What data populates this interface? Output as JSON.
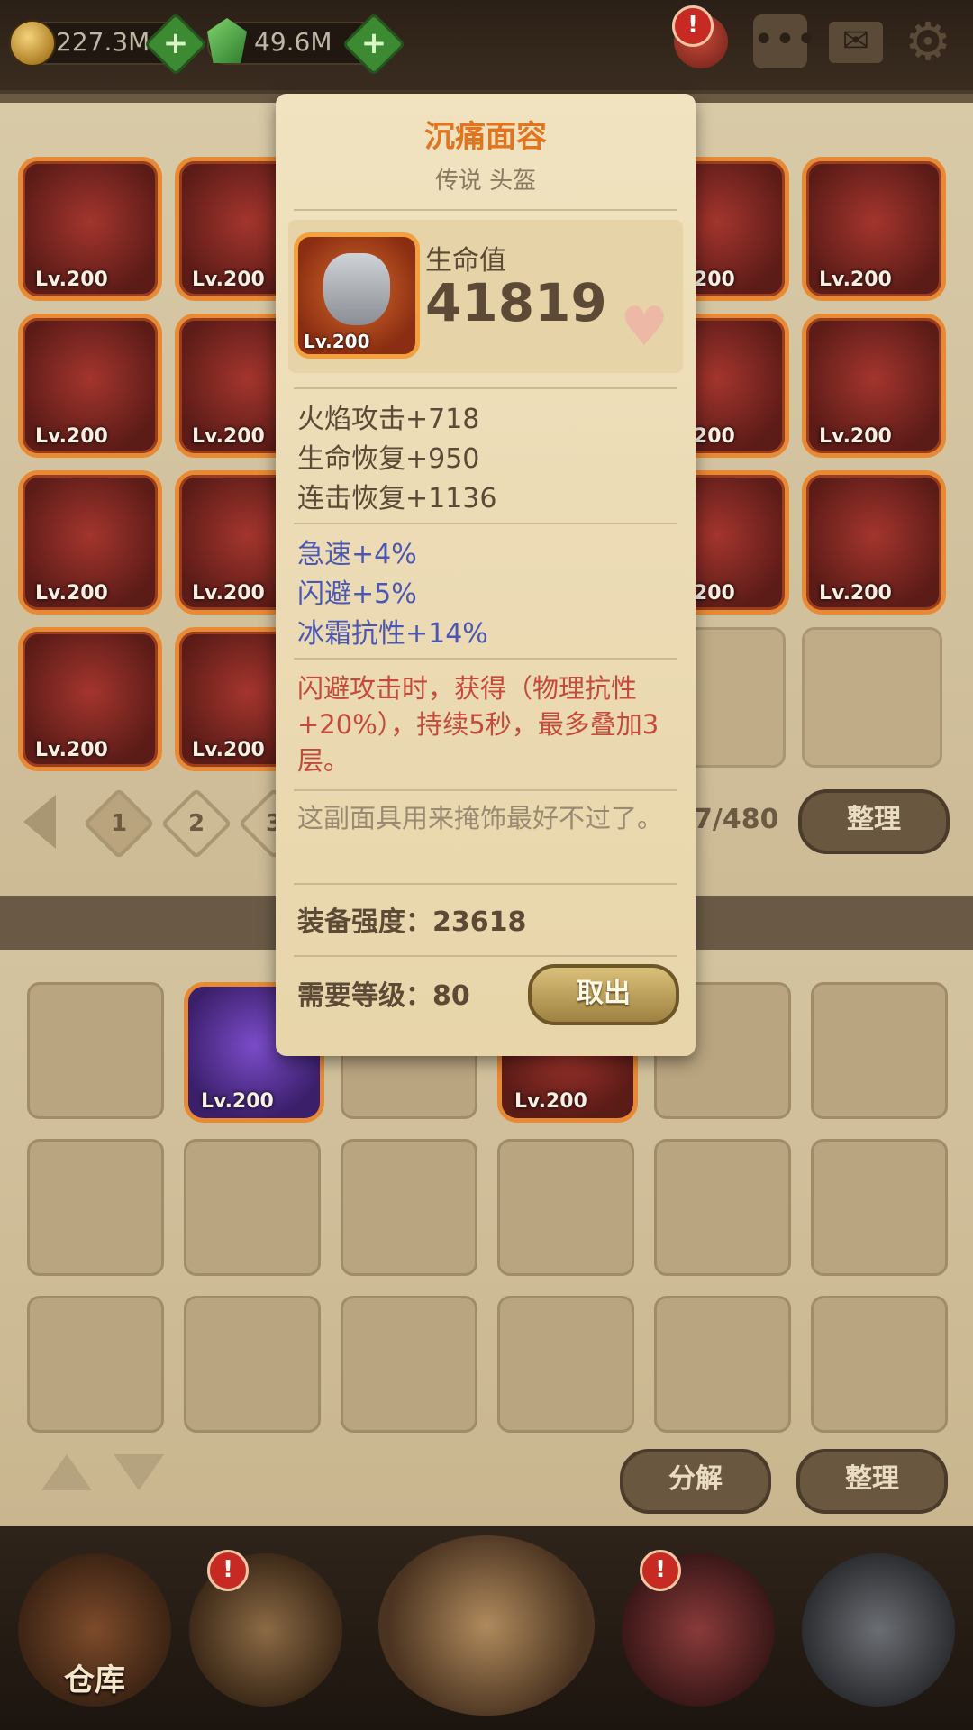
{
  "topbar": {
    "gold": "227.3M",
    "gems": "49.6M",
    "alert_glyph": "!"
  },
  "storage": {
    "level_label": "Lv.200",
    "pages": [
      "1",
      "2",
      "3"
    ],
    "count": "7/480",
    "sort_label": "整理"
  },
  "bag": {
    "level_label": "Lv.200",
    "decompose_label": "分解",
    "sort_label": "整理"
  },
  "nav": {
    "warehouse_label": "仓库",
    "alert_glyph": "!"
  },
  "item": {
    "name": "沉痛面容",
    "subtitle": "传说 头盔",
    "level": "Lv.200",
    "main_stat_label": "生命值",
    "main_stat_value": "41819",
    "stats": [
      "火焰攻击+718",
      "生命恢复+950",
      "连击恢复+1136"
    ],
    "bonus_stats": [
      "急速+4%",
      "闪避+5%",
      "冰霜抗性+14%"
    ],
    "effect": "闪避攻击时，获得（物理抗性+20%），持续5秒，最多叠加3层。",
    "flavor": "这副面具用来掩饰最好不过了。",
    "power_label": "装备强度：23618",
    "required_level": "需要等级：80",
    "take_out_label": "取出"
  },
  "colors": {
    "title_orange": "#e0741f",
    "bonus_blue": "#4b57b3",
    "effect_red": "#c44b3b"
  }
}
